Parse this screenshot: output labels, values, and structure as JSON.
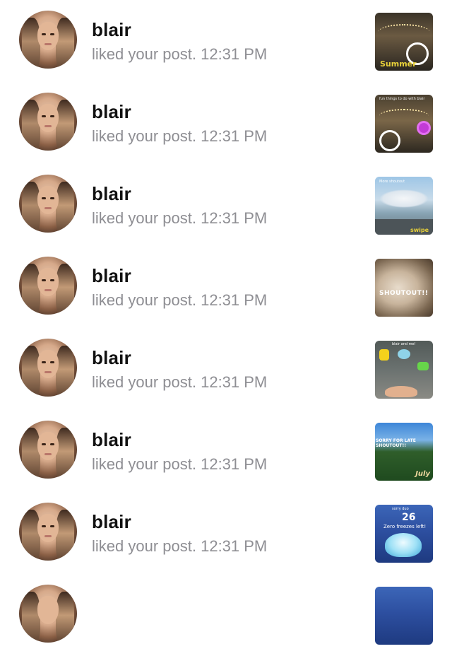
{
  "notifications": [
    {
      "user": "blair",
      "action": "liked your post.",
      "time": "12:31 PM",
      "thumb": {
        "caption": "Summer"
      }
    },
    {
      "user": "blair",
      "action": "liked your post.",
      "time": "12:31 PM",
      "thumb": {
        "caption": "fun things to do with blair"
      }
    },
    {
      "user": "blair",
      "action": "liked your post.",
      "time": "12:31 PM",
      "thumb": {
        "caption": "More shoutout",
        "extra": "swipe"
      }
    },
    {
      "user": "blair",
      "action": "liked your post.",
      "time": "12:31 PM",
      "thumb": {
        "caption": "SHOUTOUT!!"
      }
    },
    {
      "user": "blair",
      "action": "liked your post.",
      "time": "12:31 PM",
      "thumb": {
        "caption": "blair and me!"
      }
    },
    {
      "user": "blair",
      "action": "liked your post.",
      "time": "12:31 PM",
      "thumb": {
        "caption": "SORRY FOR LATE SHOUTOUT!!",
        "extra": "July"
      }
    },
    {
      "user": "blair",
      "action": "liked your post.",
      "time": "12:31 PM",
      "thumb": {
        "top": "sorry duo",
        "count": "26",
        "caption": "Zero freezes left!"
      }
    }
  ],
  "colors": {
    "username": "#111111",
    "secondary": "#8e8e93",
    "background": "#ffffff"
  }
}
